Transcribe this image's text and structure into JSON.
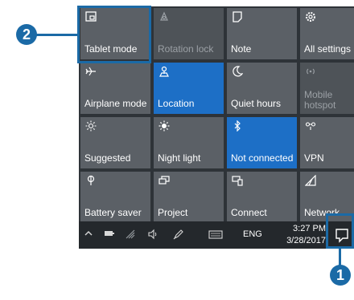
{
  "tiles": [
    {
      "label": "Tablet mode",
      "icon": "tablet-mode-icon",
      "state": "off"
    },
    {
      "label": "Rotation lock",
      "icon": "rotation-lock-icon",
      "state": "disabled"
    },
    {
      "label": "Note",
      "icon": "note-icon",
      "state": "off"
    },
    {
      "label": "All settings",
      "icon": "gear-icon",
      "state": "off"
    },
    {
      "label": "Airplane mode",
      "icon": "airplane-icon",
      "state": "off"
    },
    {
      "label": "Location",
      "icon": "location-icon",
      "state": "on"
    },
    {
      "label": "Quiet hours",
      "icon": "moon-icon",
      "state": "off"
    },
    {
      "label": "Mobile hotspot",
      "icon": "hotspot-icon",
      "state": "disabled"
    },
    {
      "label": "Suggested",
      "icon": "brightness-icon",
      "state": "off"
    },
    {
      "label": "Night light",
      "icon": "night-light-icon",
      "state": "off"
    },
    {
      "label": "Not connected",
      "icon": "bluetooth-icon",
      "state": "on"
    },
    {
      "label": "VPN",
      "icon": "vpn-icon",
      "state": "off"
    },
    {
      "label": "Battery saver",
      "icon": "battery-saver-icon",
      "state": "off"
    },
    {
      "label": "Project",
      "icon": "project-icon",
      "state": "off"
    },
    {
      "label": "Connect",
      "icon": "connect-icon",
      "state": "off"
    },
    {
      "label": "Network",
      "icon": "network-icon",
      "state": "off"
    }
  ],
  "taskbar": {
    "language": "ENG",
    "time": "3:27 PM",
    "date": "3/28/2017",
    "icons": [
      "chevron-up-icon",
      "battery-icon",
      "wifi-icon",
      "volume-icon",
      "pen-icon",
      "keyboard-icon",
      "action-center-icon"
    ]
  },
  "callouts": {
    "one": "1",
    "two": "2"
  },
  "colors": {
    "tile": "#5b6066",
    "tile_on": "#1d6fc6",
    "taskbar": "#24282c",
    "callout": "#1b6aa6"
  }
}
